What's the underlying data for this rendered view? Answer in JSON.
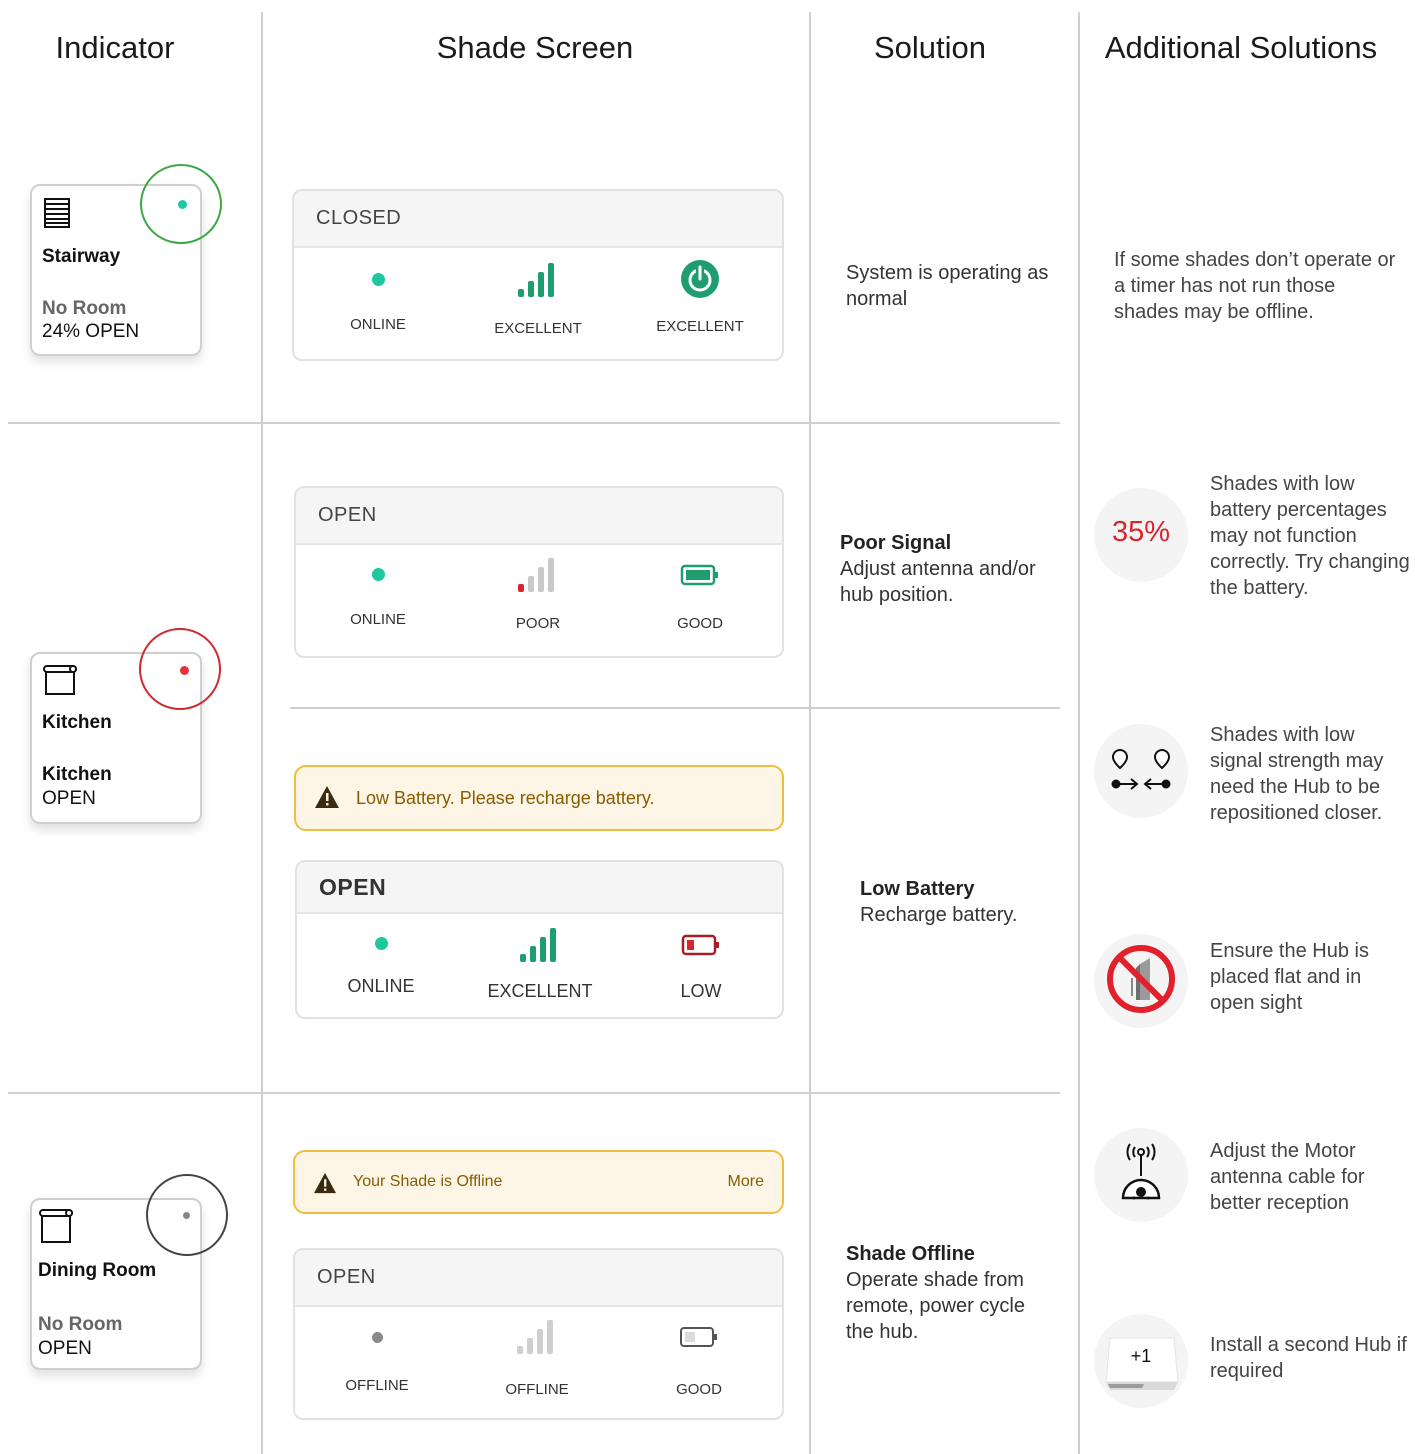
{
  "headers": {
    "indicator": "Indicator",
    "shade_screen": "Shade Screen",
    "solution": "Solution",
    "additional": "Additional Solutions"
  },
  "rows": {
    "stairway": {
      "card": {
        "name": "Stairway",
        "room": "No Room",
        "state": "24% OPEN",
        "dot_color": "#1ec7a0",
        "ring_color": "#3aa845"
      },
      "panel": {
        "title": "CLOSED",
        "status": "ONLINE",
        "signal": "EXCELLENT",
        "battery": "EXCELLENT"
      },
      "solution": "System is operating as normal"
    },
    "kitchen": {
      "card": {
        "name": "Kitchen",
        "room": "Kitchen",
        "state": "OPEN",
        "dot_color": "#e3323a",
        "ring_color": "#cc2a2f"
      },
      "panel_signal": {
        "title": "OPEN",
        "status": "ONLINE",
        "signal": "POOR",
        "battery": "GOOD"
      },
      "solution_signal": {
        "title": "Poor Signal",
        "body": "Adjust antenna and/or hub position."
      },
      "banner": {
        "text": "Low Battery. Please recharge battery."
      },
      "panel_battery": {
        "title": "OPEN",
        "status": "ONLINE",
        "signal": "EXCELLENT",
        "battery": "LOW"
      },
      "solution_battery": {
        "title": "Low Battery",
        "body": "Recharge battery."
      }
    },
    "dining": {
      "card": {
        "name": "Dining Room",
        "room": "No Room",
        "state": "OPEN",
        "dot_color": "#888888",
        "ring_color": "#444444"
      },
      "banner": {
        "text": "Your Shade is Offline",
        "more": "More"
      },
      "panel": {
        "title": "OPEN",
        "status": "OFFLINE",
        "signal": "OFFLINE",
        "battery": "GOOD"
      },
      "solution": {
        "title": "Shade Offline",
        "body": "Operate shade from remote, power cycle the hub."
      }
    }
  },
  "additional": {
    "intro": "If some shades don’t operate or a timer has not run those shades may be offline.",
    "items": [
      {
        "icon": "battery-percent-icon",
        "icon_text": "35%",
        "text": "Shades with low battery percentages may not function correctly. Try changing the battery."
      },
      {
        "icon": "move-closer-icon",
        "text": "Shades with low signal strength may need the Hub to be repositioned closer."
      },
      {
        "icon": "no-tilted-hub-icon",
        "text": "Ensure the Hub is placed flat and in open sight"
      },
      {
        "icon": "motor-antenna-icon",
        "text": "Adjust the Motor antenna cable for better reception"
      },
      {
        "icon": "add-hub-icon",
        "icon_text": "+1",
        "text": "Install a second Hub if required"
      }
    ]
  },
  "colors": {
    "green": "#1e9e6e",
    "teal_dot": "#1ec7a0",
    "red": "#d6262e",
    "grid_line": "#cfcfcf",
    "banner_border": "#f2bc3d"
  }
}
